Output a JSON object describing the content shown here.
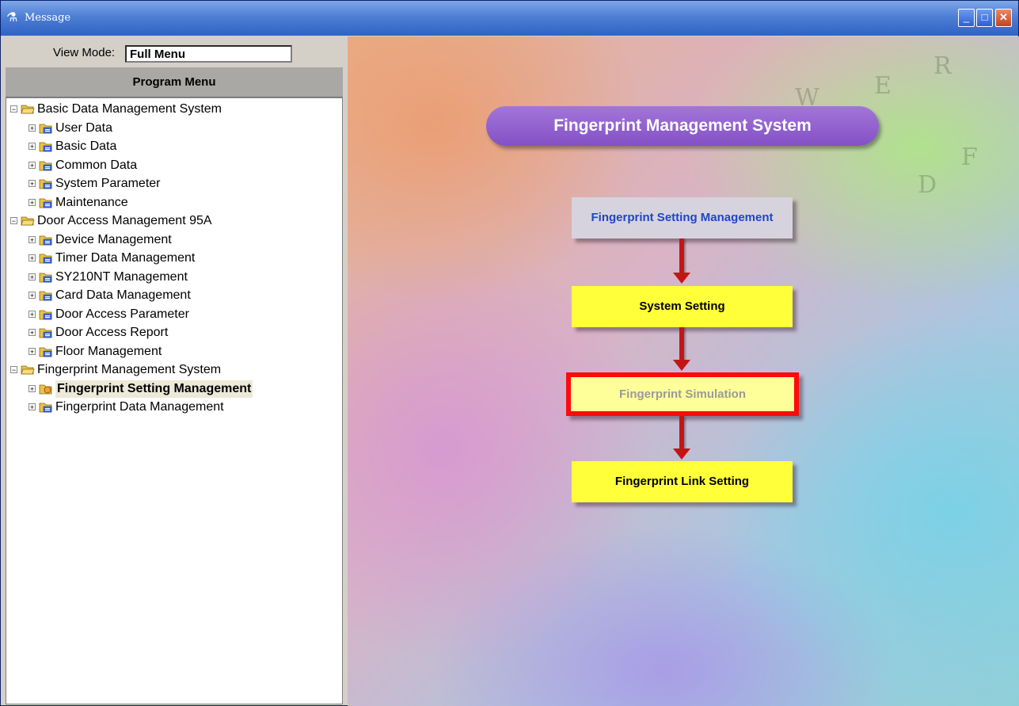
{
  "window": {
    "title": "Message",
    "icon": "app-person-icon",
    "controls": [
      "minimize-icon",
      "maximize-icon",
      "close-icon"
    ]
  },
  "view_mode": {
    "label": "View Mode:",
    "value": "Full Menu"
  },
  "program_menu": {
    "header": "Program Menu",
    "tree": [
      {
        "label": "Basic Data Management System",
        "level": 0,
        "icon": "folder-open-icon",
        "expander": "−"
      },
      {
        "label": "User Data",
        "level": 1,
        "icon": "folder-form-icon",
        "expander": "+"
      },
      {
        "label": "Basic Data",
        "level": 1,
        "icon": "folder-form-icon",
        "expander": "+"
      },
      {
        "label": "Common Data",
        "level": 1,
        "icon": "folder-form-icon",
        "expander": "+"
      },
      {
        "label": "System Parameter",
        "level": 1,
        "icon": "folder-form-icon",
        "expander": "+"
      },
      {
        "label": "Maintenance",
        "level": 1,
        "icon": "folder-form-icon",
        "expander": "+"
      },
      {
        "label": "Door Access Management 95A",
        "level": 0,
        "icon": "folder-open-icon",
        "expander": "−"
      },
      {
        "label": "Device Management",
        "level": 1,
        "icon": "folder-form-icon",
        "expander": "+"
      },
      {
        "label": "Timer Data Management",
        "level": 1,
        "icon": "folder-form-icon",
        "expander": "+"
      },
      {
        "label": "SY210NT Management",
        "level": 1,
        "icon": "folder-form-icon",
        "expander": "+"
      },
      {
        "label": "Card Data Management",
        "level": 1,
        "icon": "folder-form-icon",
        "expander": "+"
      },
      {
        "label": "Door Access Parameter",
        "level": 1,
        "icon": "folder-form-icon",
        "expander": "+"
      },
      {
        "label": "Door Access Report",
        "level": 1,
        "icon": "folder-form-icon",
        "expander": "+"
      },
      {
        "label": "Floor Management",
        "level": 1,
        "icon": "folder-form-icon",
        "expander": "+"
      },
      {
        "label": "Fingerprint Management System",
        "level": 0,
        "icon": "folder-open-icon",
        "expander": "−"
      },
      {
        "label": "Fingerprint Setting Management",
        "level": 1,
        "icon": "folder-active-icon",
        "expander": "+",
        "selected": true
      },
      {
        "label": "Fingerprint Data Management",
        "level": 1,
        "icon": "folder-form-icon",
        "expander": "+"
      }
    ]
  },
  "flow": {
    "banner": "Fingerprint Management System",
    "steps": {
      "setting": "Fingerprint Setting Management",
      "system": "System Setting",
      "simulation": "Fingerprint Simulation",
      "link": "Fingerprint Link Setting"
    }
  }
}
